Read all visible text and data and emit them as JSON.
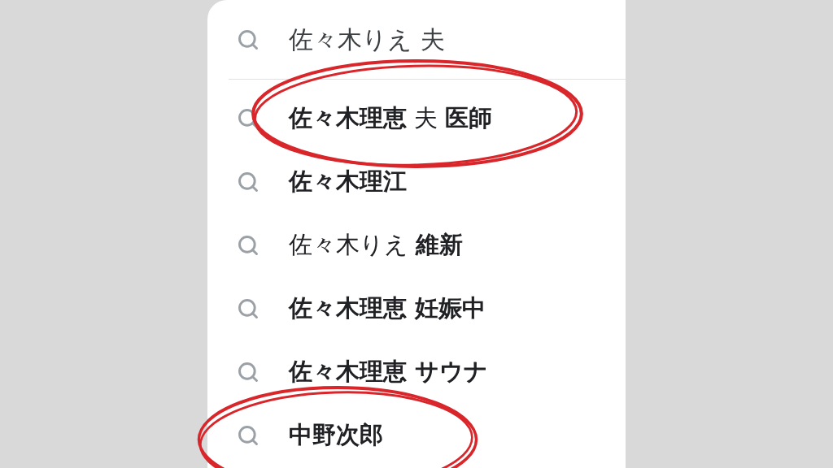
{
  "search": {
    "value": "佐々木りえ 夫"
  },
  "suggestions": [
    {
      "text": "**佐々木理恵** 夫 **医師**",
      "bold": false,
      "circled": true
    },
    {
      "text": "佐々木理江",
      "bold": true,
      "circled": false
    },
    {
      "text": "佐々木りえ **維新**",
      "bold": false,
      "circled": false
    },
    {
      "text": "佐々木理恵 妊娠中",
      "bold": true,
      "circled": false
    },
    {
      "text": "佐々木理恵 サウナ",
      "bold": true,
      "circled": false
    },
    {
      "text": "中野次郎",
      "bold": true,
      "circled": true
    }
  ]
}
